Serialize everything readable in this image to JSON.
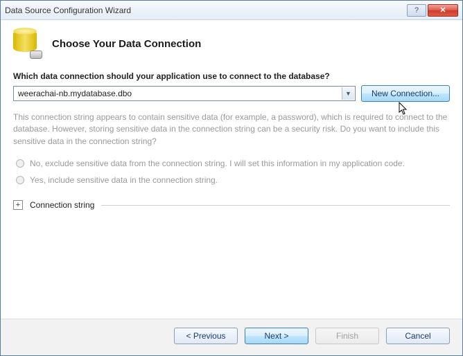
{
  "titlebar": {
    "title": "Data Source Configuration Wizard",
    "help_glyph": "?",
    "close_glyph": "✕"
  },
  "header": {
    "title": "Choose Your Data Connection"
  },
  "content": {
    "question": "Which data connection should your application use to connect to the database?",
    "combo_value": "weerachai-nb.mydatabase.dbo",
    "new_connection_label": "New Connection...",
    "sensitive_info": "This connection string appears to contain sensitive data (for example, a password), which is required to connect to the database. However, storing sensitive data in the connection string can be a security risk. Do you want to include this sensitive data in the connection string?",
    "radio_no": "No, exclude sensitive data from the connection string. I will set this information in my application code.",
    "radio_yes": "Yes, include sensitive data in the connection string.",
    "expander_label": "Connection string",
    "expander_glyph": "+"
  },
  "footer": {
    "previous": "< Previous",
    "next": "Next >",
    "finish": "Finish",
    "cancel": "Cancel"
  }
}
